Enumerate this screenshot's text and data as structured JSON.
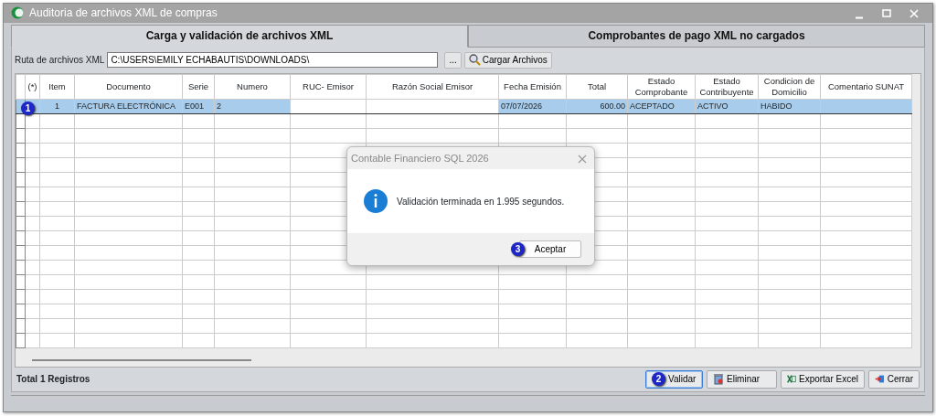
{
  "window": {
    "title": "Auditoria de archivos XML de compras"
  },
  "tabs": [
    {
      "label": "Carga y validación de archivos XML",
      "selected": true
    },
    {
      "label": "Comprobantes de pago XML no cargados",
      "selected": false
    }
  ],
  "path": {
    "label": "Ruta de archivos XML",
    "value": "C:\\USERS\\EMILY ECHABAUTIS\\DOWNLOADS\\",
    "browse_button": "...",
    "load_button": "Cargar Archivos"
  },
  "table": {
    "columns": [
      "(*)",
      "Item",
      "Documento",
      "Serie",
      "Numero",
      "RUC- Emisor",
      "Razón Social Emisor",
      "Fecha Emisión",
      "Total",
      "Estado Comprobante",
      "Estado Contribuyente",
      "Condicion de Domicilio",
      "Comentario SUNAT"
    ],
    "rows": [
      {
        "selected": true,
        "annotation": "1",
        "cells": [
          "",
          "1",
          "FACTURA ELECTRÓNICA",
          "E001",
          "2",
          "",
          "",
          "07/07/2026",
          "600.00",
          "ACEPTADO",
          "ACTIVO",
          "HABIDO",
          ""
        ]
      }
    ]
  },
  "total": "Total 1 Registros",
  "buttons": [
    {
      "label": "Validar",
      "kind": "validate",
      "annotation": "2",
      "focused": true
    },
    {
      "label": "Eliminar",
      "kind": "delete",
      "focused": false
    },
    {
      "label": "Exportar Excel",
      "kind": "excel",
      "focused": false
    },
    {
      "label": "Cerrar",
      "kind": "close",
      "focused": false
    }
  ],
  "dialog": {
    "title": "Contable Financiero SQL 2026",
    "message": "Validación terminada en 1.995 segundos.",
    "button": "Aceptar",
    "annotation": "3"
  }
}
